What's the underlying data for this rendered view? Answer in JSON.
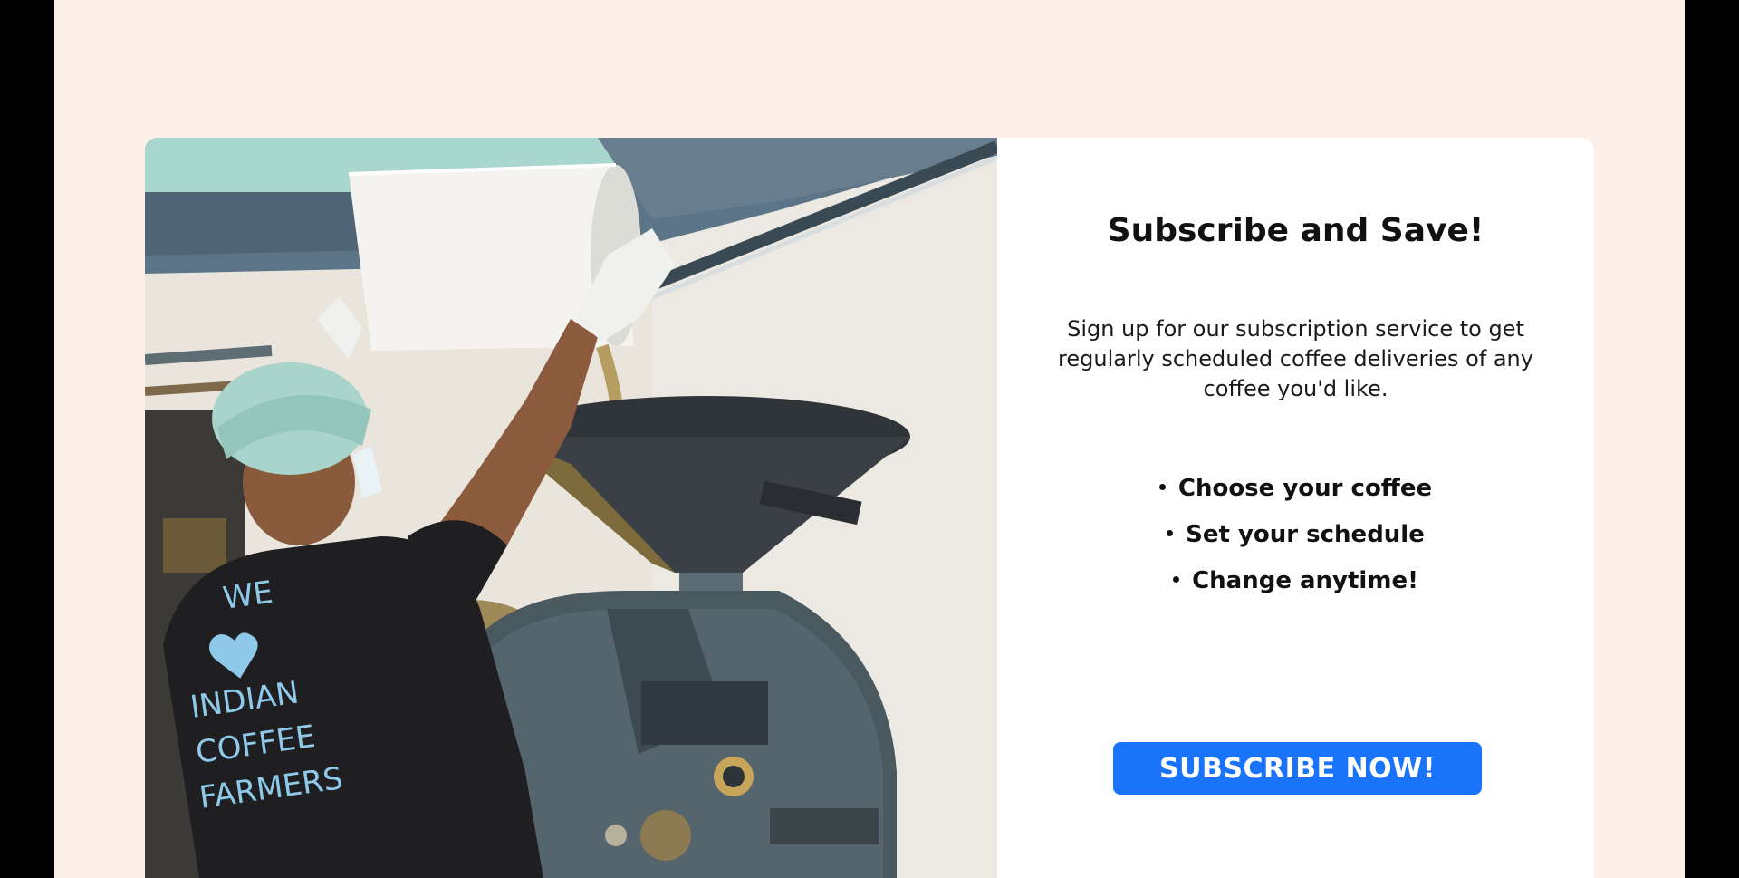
{
  "subscription": {
    "title": "Subscribe and Save!",
    "description": "Sign up for our subscription service to get regularly scheduled coffee deliveries of any coffee you'd like.",
    "features": [
      "Choose your coffee",
      "Set your schedule",
      "Change anytime!"
    ],
    "cta_label": "SUBSCRIBE NOW!"
  },
  "photo": {
    "shirt_text": [
      "WE",
      "INDIAN",
      "COFFEE",
      "FARMERS"
    ]
  },
  "colors": {
    "page_background": "#fdf1e9",
    "card_background": "#ffffff",
    "button": "#1a73fb",
    "text": "#111111"
  }
}
